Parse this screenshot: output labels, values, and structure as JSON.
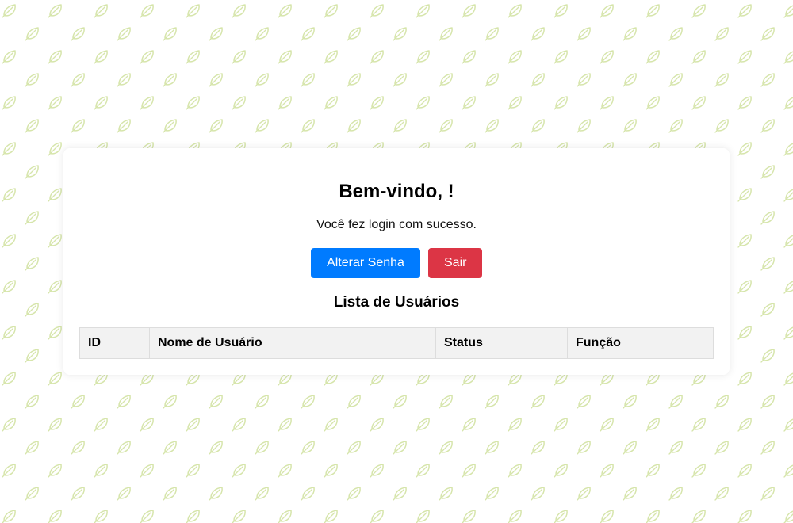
{
  "colors": {
    "leaf": "#d4e4a8",
    "primary_button": "#007bff",
    "danger_button": "#dc3545",
    "table_header_bg": "#f2f2f2"
  },
  "icons": {
    "background_pattern": "leaf-icon"
  },
  "welcome": {
    "title": "Bem-vindo, !",
    "message": "Você fez login com sucesso."
  },
  "actions": {
    "change_password_label": "Alterar Senha",
    "logout_label": "Sair"
  },
  "users_section": {
    "title": "Lista de Usuários",
    "columns": [
      "ID",
      "Nome de Usuário",
      "Status",
      "Função"
    ],
    "rows": []
  }
}
